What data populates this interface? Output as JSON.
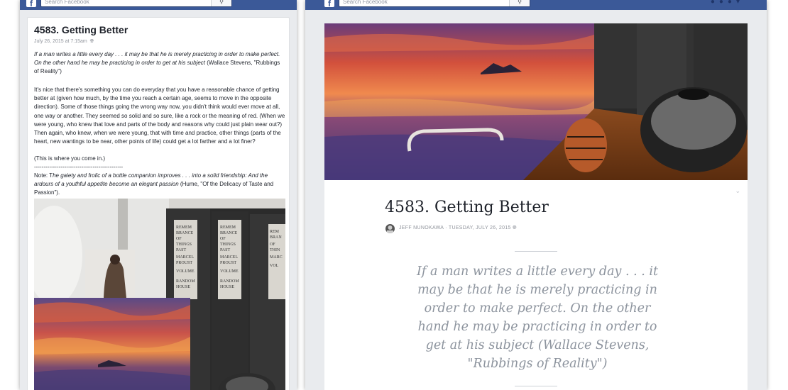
{
  "left_window": {
    "search_placeholder": "Search Facebook",
    "post": {
      "title": "4583. Getting Better",
      "meta": "July 26, 2015 at 7:15am",
      "quote_italic": "If a man writes a little every day . . .  it may be that he is merely practicing in order to make perfect. On the other hand he may be practicing in order to get at his subject",
      "quote_attrib": " (Wallace Stevens, \"Rubbings of Reality\")",
      "body": "It's nice that there's something you can do everyday that you have a reasonable chance of getting better at (given how much, by the time you reach a certain age, seems to move in the opposite direction). Some of those things going the wrong way now, you didn't think would ever move at all, one way or another. They seemed so solid and so sure, like a rock or the meaning of red. (When we were young, who knew that love and parts of the body and reasons why could just plain wear out?) Then again, who knew, when we were young, that with time and practice, other things (parts of the heart, new wantings to be near, other points of life) could get a lot farther and a lot finer?",
      "closing": "(This is where you come in.)",
      "divider": "-----------------------------------------------",
      "note_lead": "Note: T",
      "note_italic": "he gaiety and frolic of a bottle companion improves . . .  into a solid friendship: And the ardours of a youthful appetite become an elegant passion",
      "note_attrib": " (Hume, \"Of the Delicacy of Taste and Passion\")."
    },
    "book_spine_text": "REMEMBRANCE OF THINGS PAST MARCEL PROUST VOLUME RANDOM HOUSE"
  },
  "right_window": {
    "search_placeholder": "Search Facebook",
    "article": {
      "title": "4583. Getting Better",
      "author": "JEFF NUNOKAWA",
      "separator": "·",
      "date": "TUESDAY, JULY 26, 2015",
      "quote": "If a man writes a little every day . . .  it may be that he is merely practicing in order to make perfect. On the other hand he may be practicing in order to get at his subject (Wallace Stevens, \"Rubbings of Reality\")"
    }
  },
  "colors": {
    "facebook_blue": "#3b5998",
    "page_bg": "#e9ebee",
    "meta_gray": "#90949c"
  },
  "icons": [
    "facebook-logo-icon",
    "search-icon",
    "globe-icon",
    "friends-icon",
    "messages-icon",
    "notifications-icon",
    "chevron-down-icon"
  ]
}
